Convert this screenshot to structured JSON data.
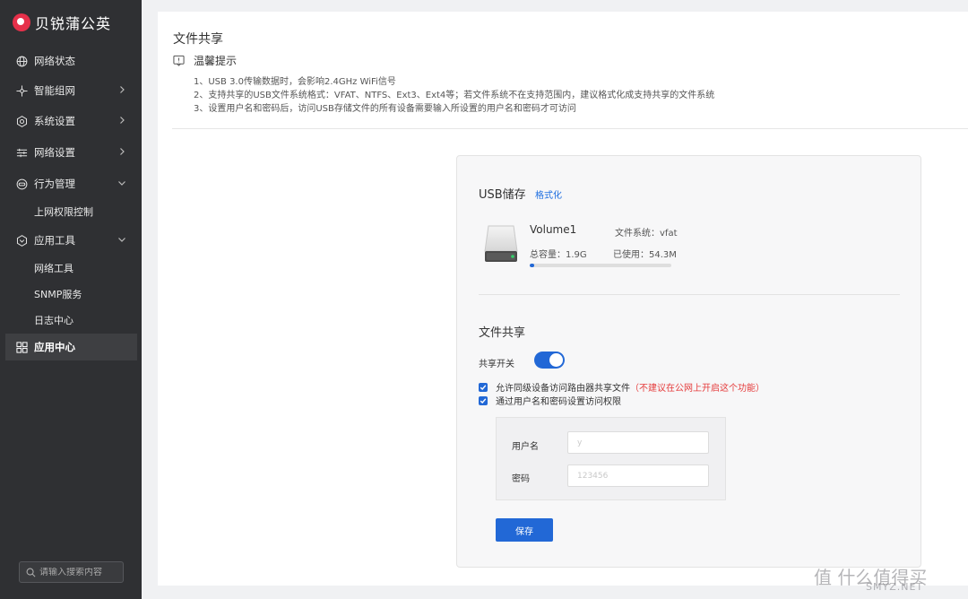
{
  "brand": {
    "name": "贝锐蒲公英"
  },
  "sidebar": {
    "items": [
      {
        "label": "网络状态",
        "icon": "globe-icon"
      },
      {
        "label": "智能组网",
        "icon": "network-icon"
      },
      {
        "label": "系统设置",
        "icon": "gear-icon"
      },
      {
        "label": "网络设置",
        "icon": "sliders-icon"
      },
      {
        "label": "行为管理",
        "icon": "eye-icon"
      },
      {
        "label": "上网权限控制"
      },
      {
        "label": "应用工具",
        "icon": "tools-icon"
      },
      {
        "label": "网络工具"
      },
      {
        "label": "SNMP服务"
      },
      {
        "label": "日志中心"
      },
      {
        "label": "应用中心",
        "icon": "apps-icon"
      }
    ],
    "search_placeholder": "请输入搜索内容"
  },
  "main": {
    "title": "文件共享",
    "tip_title": "温馨提示",
    "tips": [
      "1、USB 3.0传输数据时，会影响2.4GHz WiFi信号",
      "2、支持共享的USB文件系统格式：VFAT、NTFS、Ext3、Ext4等；若文件系统不在支持范围内，建议格式化成支持共享的文件系统",
      "3、设置用户名和密码后，访问USB存储文件的所有设备需要输入所设置的用户名和密码才可访问"
    ]
  },
  "usb": {
    "title": "USB储存",
    "format_link": "格式化",
    "volume_name": "Volume1",
    "fs_label": "文件系统：vfat",
    "capacity_label": "总容量：1.9G",
    "used_label": "已使用：54.3M",
    "used_fraction": 0.028
  },
  "share": {
    "title": "文件共享",
    "toggle_label": "共享开关",
    "toggle_on": true,
    "allow_label": "允许同级设备访问路由器共享文件",
    "allow_warning": "（不建议在公网上开启这个功能）",
    "auth_label": "通过用户名和密码设置访问权限",
    "username_label": "用户名",
    "username_value": "y",
    "password_label": "密码",
    "password_value": "123456",
    "save_label": "保存"
  },
  "watermark": {
    "line1": "值 什么值得买",
    "line2": "SMYZ.NET"
  },
  "colors": {
    "accent": "#2268d6",
    "sidebar_bg": "#2f3033",
    "warning": "#e53c3c",
    "brand": "#e6304a"
  }
}
